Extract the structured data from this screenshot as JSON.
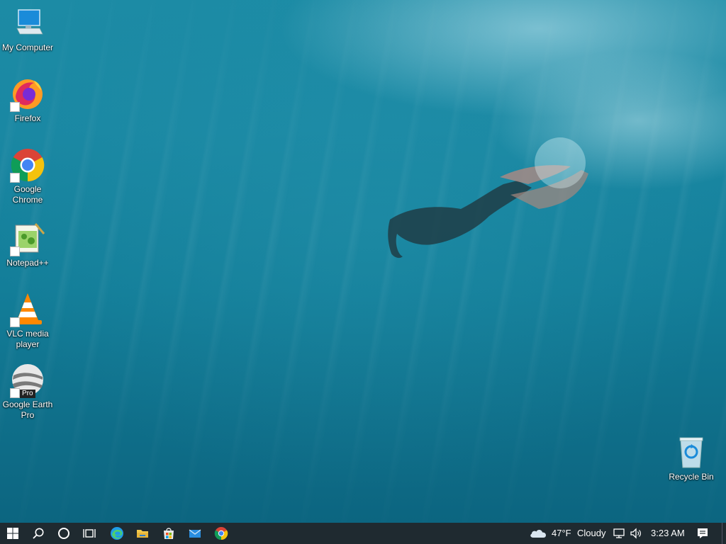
{
  "desktop_icons": [
    {
      "label": "My Computer",
      "icon": "computer-icon"
    },
    {
      "label": "Firefox",
      "icon": "firefox-icon"
    },
    {
      "label": "Google Chrome",
      "icon": "chrome-icon"
    },
    {
      "label": "Notepad++",
      "icon": "notepad-plus-plus-icon"
    },
    {
      "label": "VLC media player",
      "icon": "vlc-icon"
    },
    {
      "label": "Google Earth Pro",
      "icon": "google-earth-pro-icon",
      "badge": "Pro"
    },
    {
      "label": "Recycle Bin",
      "icon": "recycle-bin-icon"
    }
  ],
  "taskbar": {
    "pinned": [
      "start-icon",
      "search-icon",
      "cortana-icon",
      "task-view-icon",
      "edge-icon",
      "file-explorer-icon",
      "store-icon",
      "mail-icon",
      "chrome-icon"
    ],
    "weather": {
      "temperature": "47°F",
      "condition": "Cloudy",
      "icon": "cloud-icon"
    },
    "clock": "3:23 AM"
  },
  "colors": {
    "taskbar_bg": "#1f2a30",
    "water": "#1a88a3"
  }
}
